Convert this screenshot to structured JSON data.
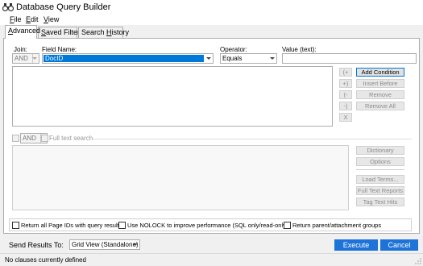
{
  "window": {
    "title": "Database Query Builder"
  },
  "menu": [
    {
      "key": "F",
      "rest": "ile"
    },
    {
      "key": "E",
      "rest": "dit"
    },
    {
      "key": "V",
      "rest": "iew"
    }
  ],
  "tabs": [
    {
      "key": "A",
      "rest": "dvanced"
    },
    {
      "key": "S",
      "rest": "aved Filters"
    },
    {
      "pre": "Search ",
      "key": "H",
      "rest": "istory"
    }
  ],
  "clause": {
    "join_label": "Join:",
    "join_value": "AND",
    "field_label": "Field Name:",
    "field_value": "DocID",
    "operator_label": "Operator:",
    "operator_value": "Equals",
    "value_label": "Value (text):",
    "value_value": ""
  },
  "clause_side_buttons": [
    "(+",
    "+)",
    "(-",
    "-)",
    "X"
  ],
  "clause_actions": [
    "Add Condition",
    "Insert Before",
    "Remove",
    "Remove All"
  ],
  "fulltext": {
    "join_value": "AND",
    "label": "Full text search"
  },
  "fulltext_actions": [
    "Dictionary",
    "Options",
    "Load Terms...",
    "Full Text Reports",
    "Tag Text Hits"
  ],
  "options": [
    "Return all Page IDs with query results",
    "Use NOLOCK to improve performance (SQL only/read-only)",
    "Return parent/attachment groups"
  ],
  "send_results": {
    "label": "Send Results To:",
    "value": "Grid View (Standalone)"
  },
  "buttons": {
    "execute": "Execute",
    "cancel": "Cancel"
  },
  "status": "No clauses currently defined"
}
